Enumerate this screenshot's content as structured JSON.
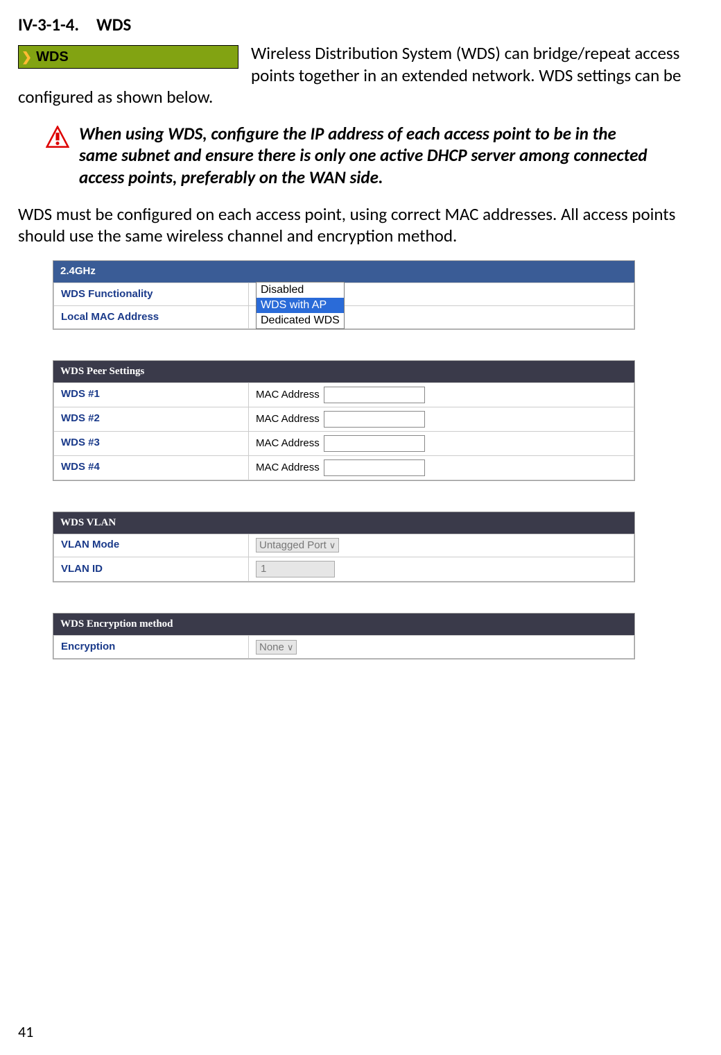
{
  "title": "IV-3-1-4. WDS",
  "badge_label": "WDS",
  "intro": "Wireless Distribution System (WDS) can bridge/repeat access points together in an extended network. WDS settings can be configured as shown below.",
  "note": "When using WDS, configure the IP address of each access point to be in the same subnet and ensure there is only one active DHCP server among connected access points, preferably on the WAN side.",
  "para2": "WDS must be configured on each access point, using correct MAC addresses. All access points should use the same wireless channel and encryption method.",
  "panel1": {
    "header": "2.4GHz",
    "row1_label": "WDS Functionality",
    "row2_label": "Local MAC Address",
    "dropdown": {
      "opt1": "Disabled",
      "opt2": "WDS with AP",
      "opt3": "Dedicated WDS"
    }
  },
  "panel2": {
    "header": "WDS Peer Settings",
    "rows": [
      {
        "label": "WDS #1",
        "field": "MAC Address"
      },
      {
        "label": "WDS #2",
        "field": "MAC Address"
      },
      {
        "label": "WDS #3",
        "field": "MAC Address"
      },
      {
        "label": "WDS #4",
        "field": "MAC Address"
      }
    ]
  },
  "panel3": {
    "header": "WDS VLAN",
    "row1_label": "VLAN Mode",
    "row1_value": "Untagged Port",
    "row2_label": "VLAN ID",
    "row2_value": "1"
  },
  "panel4": {
    "header": "WDS Encryption method",
    "row1_label": "Encryption",
    "row1_value": "None"
  },
  "page_number": "41"
}
